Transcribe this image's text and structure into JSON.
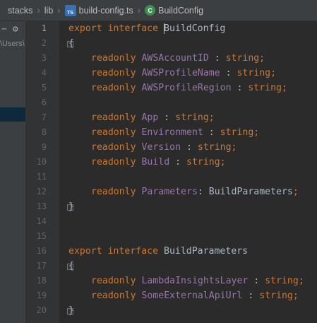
{
  "breadcrumb": {
    "items": [
      "stacks",
      "lib",
      "build-config.ts",
      "BuildConfig"
    ],
    "file_icon": "typescript-file-icon",
    "symbol_icon": "class-icon"
  },
  "left_panel": {
    "path_fragment": "\\Users\\"
  },
  "editor": {
    "line_numbers": [
      "1",
      "2",
      "3",
      "4",
      "5",
      "6",
      "7",
      "8",
      "9",
      "10",
      "11",
      "12",
      "13",
      "14",
      "15",
      "16",
      "17",
      "18",
      "19",
      "20"
    ],
    "active_line": "1",
    "lines": {
      "l1": {
        "kw1": "export",
        "kw2": "interface",
        "name": "BuildConfig"
      },
      "l2": {
        "brace": "{"
      },
      "l3": {
        "kw": "readonly",
        "prop": "AWSAccountID",
        "sep": " : ",
        "type": "string",
        "end": ";"
      },
      "l4": {
        "kw": "readonly",
        "prop": "AWSProfileName",
        "sep": " : ",
        "type": "string",
        "end": ";"
      },
      "l5": {
        "kw": "readonly",
        "prop": "AWSProfileRegion",
        "sep": " : ",
        "type": "string",
        "end": ";"
      },
      "l7": {
        "kw": "readonly",
        "prop": "App",
        "sep": " : ",
        "type": "string",
        "end": ";"
      },
      "l8": {
        "kw": "readonly",
        "prop": "Environment",
        "sep": " : ",
        "type": "string",
        "end": ";"
      },
      "l9": {
        "kw": "readonly",
        "prop": "Version",
        "sep": " : ",
        "type": "string",
        "end": ";"
      },
      "l10": {
        "kw": "readonly",
        "prop": "Build",
        "sep": " : ",
        "type": "string",
        "end": ";"
      },
      "l12": {
        "kw": "readonly",
        "prop": "Parameters",
        "sep": ": ",
        "type": "BuildParameters",
        "end": ";"
      },
      "l13": {
        "brace": "}"
      },
      "l16": {
        "kw1": "export",
        "kw2": "interface",
        "name": "BuildParameters"
      },
      "l17": {
        "brace": "{"
      },
      "l18": {
        "kw": "readonly",
        "prop": "LambdaInsightsLayer",
        "sep": " : ",
        "type": "string",
        "end": ";"
      },
      "l19": {
        "kw": "readonly",
        "prop": "SomeExternalApiUrl",
        "sep": " : ",
        "type": "string",
        "end": ";"
      },
      "l20": {
        "brace": "}"
      }
    }
  },
  "colors": {
    "background": "#2b2b2b",
    "keyword": "#cc7832",
    "property": "#9876aa",
    "text": "#a9b7c6",
    "line_number": "#606366"
  }
}
